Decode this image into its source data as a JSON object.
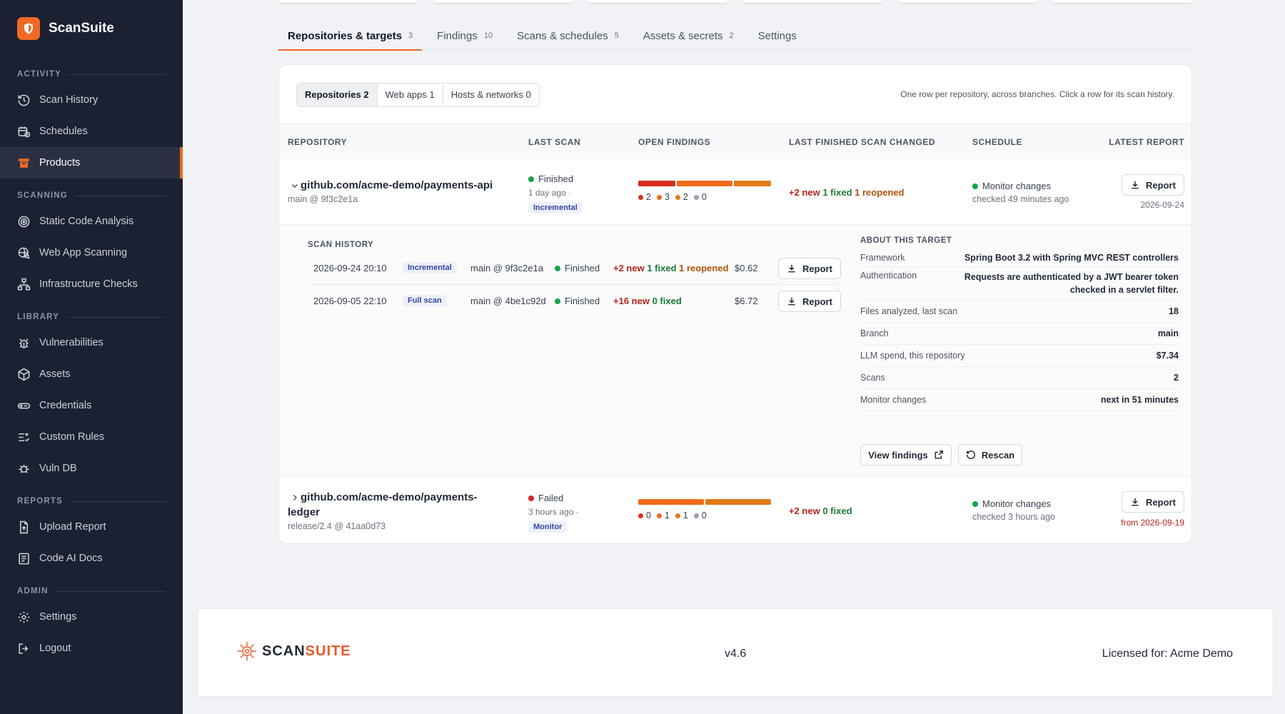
{
  "app": {
    "name": "ScanSuite"
  },
  "colors": {
    "accent": "#ef6a24",
    "sidebar_bg": "#1b2132",
    "critical": "#d92d20",
    "high": "#ef6c1a",
    "medium": "#e07b12",
    "low": "#98a2b3",
    "finished": "#16a34a",
    "failed": "#dc2626"
  },
  "sidebar": {
    "sections": [
      {
        "label": "ACTIVITY",
        "items": [
          {
            "label": "Scan History",
            "icon": "history-icon"
          },
          {
            "label": "Schedules",
            "icon": "calendar-clock-icon"
          },
          {
            "label": "Products",
            "icon": "archive-box-icon",
            "active": true
          }
        ]
      },
      {
        "label": "SCANNING",
        "items": [
          {
            "label": "Static Code Analysis",
            "icon": "target-icon"
          },
          {
            "label": "Web App Scanning",
            "icon": "globe-search-icon"
          },
          {
            "label": "Infrastructure Checks",
            "icon": "network-icon"
          }
        ]
      },
      {
        "label": "LIBRARY",
        "items": [
          {
            "label": "Vulnerabilities",
            "icon": "bug-icon"
          },
          {
            "label": "Assets",
            "icon": "cube-icon"
          },
          {
            "label": "Credentials",
            "icon": "key-icon"
          },
          {
            "label": "Custom Rules",
            "icon": "rules-icon"
          },
          {
            "label": "Vuln DB",
            "icon": "database-bug-icon"
          }
        ]
      },
      {
        "label": "REPORTS",
        "items": [
          {
            "label": "Upload Report",
            "icon": "file-upload-icon"
          },
          {
            "label": "Code AI Docs",
            "icon": "document-icon"
          }
        ]
      },
      {
        "label": "ADMIN",
        "items": [
          {
            "label": "Settings",
            "icon": "gear-icon"
          },
          {
            "label": "Logout",
            "icon": "logout-icon"
          }
        ]
      }
    ]
  },
  "tabs": [
    {
      "label": "Repositories & targets",
      "count": "3",
      "active": true
    },
    {
      "label": "Findings",
      "count": "10"
    },
    {
      "label": "Scans & schedules",
      "count": "5"
    },
    {
      "label": "Assets & secrets",
      "count": "2"
    },
    {
      "label": "Settings",
      "count": ""
    }
  ],
  "segments": [
    {
      "label": "Repositories 2",
      "active": true
    },
    {
      "label": "Web apps 1"
    },
    {
      "label": "Hosts & networks 0"
    }
  ],
  "hint": "One row per repository, across branches. Click a row for its scan history.",
  "columns": {
    "repository": "REPOSITORY",
    "last_scan": "LAST SCAN",
    "open_findings": "OPEN FINDINGS",
    "changed": "LAST FINISHED SCAN CHANGED",
    "schedule": "SCHEDULE",
    "latest_report": "LATEST REPORT"
  },
  "rows": [
    {
      "repo": "github.com/acme-demo/payments-api",
      "branch": "main @ 9f3c2e1a",
      "status": "Finished",
      "when": "1 day ago ·",
      "scan_type": "Incremental",
      "findings": {
        "critical": 2,
        "high": 3,
        "medium": 2,
        "low": 0
      },
      "change": {
        "new": "+2 new",
        "fixed": "1 fixed",
        "reopened": "1 reopened"
      },
      "schedule": "Monitor changes",
      "schedule_sub": "checked 49 minutes ago",
      "report_label": "Report",
      "report_date": "2026-09-24"
    },
    {
      "repo_line1": "github.com/acme-demo/payments-",
      "repo_line2": "ledger",
      "branch": "release/2.4 @ 41aa0d73",
      "status": "Failed",
      "when": "3 hours ago ·",
      "scan_type": "Monitor",
      "findings": {
        "critical": 0,
        "high": 1,
        "medium": 1,
        "low": 0
      },
      "change": {
        "new": "+2 new",
        "fixed": "0 fixed"
      },
      "schedule": "Monitor changes",
      "schedule_sub": "checked 3 hours ago",
      "report_label": "Report",
      "report_date": "from 2026-09-19"
    }
  ],
  "history": {
    "title": "SCAN HISTORY",
    "rows": [
      {
        "datetime": "2026-09-24 20:10",
        "type": "Incremental",
        "ref": "main @ 9f3c2e1a",
        "status": "Finished",
        "new": "+2 new",
        "fixed": "1 fixed",
        "reopened": "1 reopened",
        "cost": "$0.62",
        "report": "Report"
      },
      {
        "datetime": "2026-09-05 22:10",
        "type": "Full scan",
        "ref": "main @ 4be1c92d",
        "status": "Finished",
        "new": "+16 new",
        "fixed": "0 fixed",
        "reopened": "",
        "cost": "$6.72",
        "report": "Report"
      }
    ]
  },
  "about": {
    "title": "ABOUT THIS TARGET",
    "items": [
      {
        "k": "Framework",
        "v": "Spring Boot 3.2 with Spring MVC REST controllers"
      },
      {
        "k": "Authentication",
        "v": "Requests are authenticated by a JWT bearer token checked in a servlet filter."
      },
      {
        "k": "Files analyzed, last scan",
        "v": "18"
      },
      {
        "k": "Branch",
        "v": "main"
      },
      {
        "k": "LLM spend, this repository",
        "v": "$7.34"
      },
      {
        "k": "Scans",
        "v": "2"
      },
      {
        "k": "Monitor changes",
        "v": "next in 51 minutes"
      }
    ],
    "view_findings": "View findings",
    "rescan": "Rescan"
  },
  "footer": {
    "logo_a": "SCAN",
    "logo_b": "SUITE",
    "version": "v4.6",
    "license": "Licensed for: Acme Demo"
  }
}
